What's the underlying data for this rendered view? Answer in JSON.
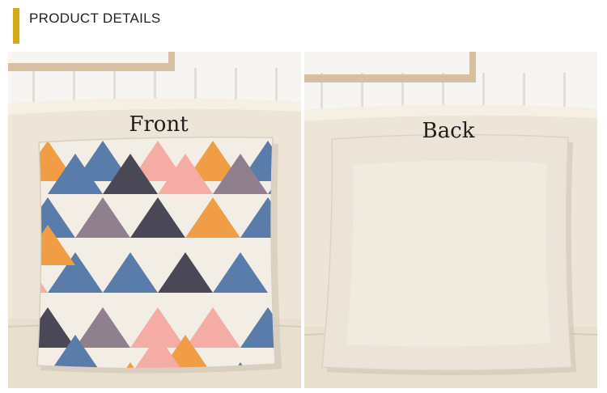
{
  "header": {
    "title": "PRODUCT DETAILS",
    "accent_color": "#d4a91a"
  },
  "panels": [
    {
      "label": "Front",
      "image": "geometric-triangle-pattern-cushion",
      "triangle_colors": [
        "#4f74a6",
        "#3f3d4d",
        "#f4a7a0",
        "#f0973a",
        "#8a7886"
      ]
    },
    {
      "label": "Back",
      "image": "plain-linen-cushion",
      "fabric_color": "#ece4d8"
    }
  ]
}
